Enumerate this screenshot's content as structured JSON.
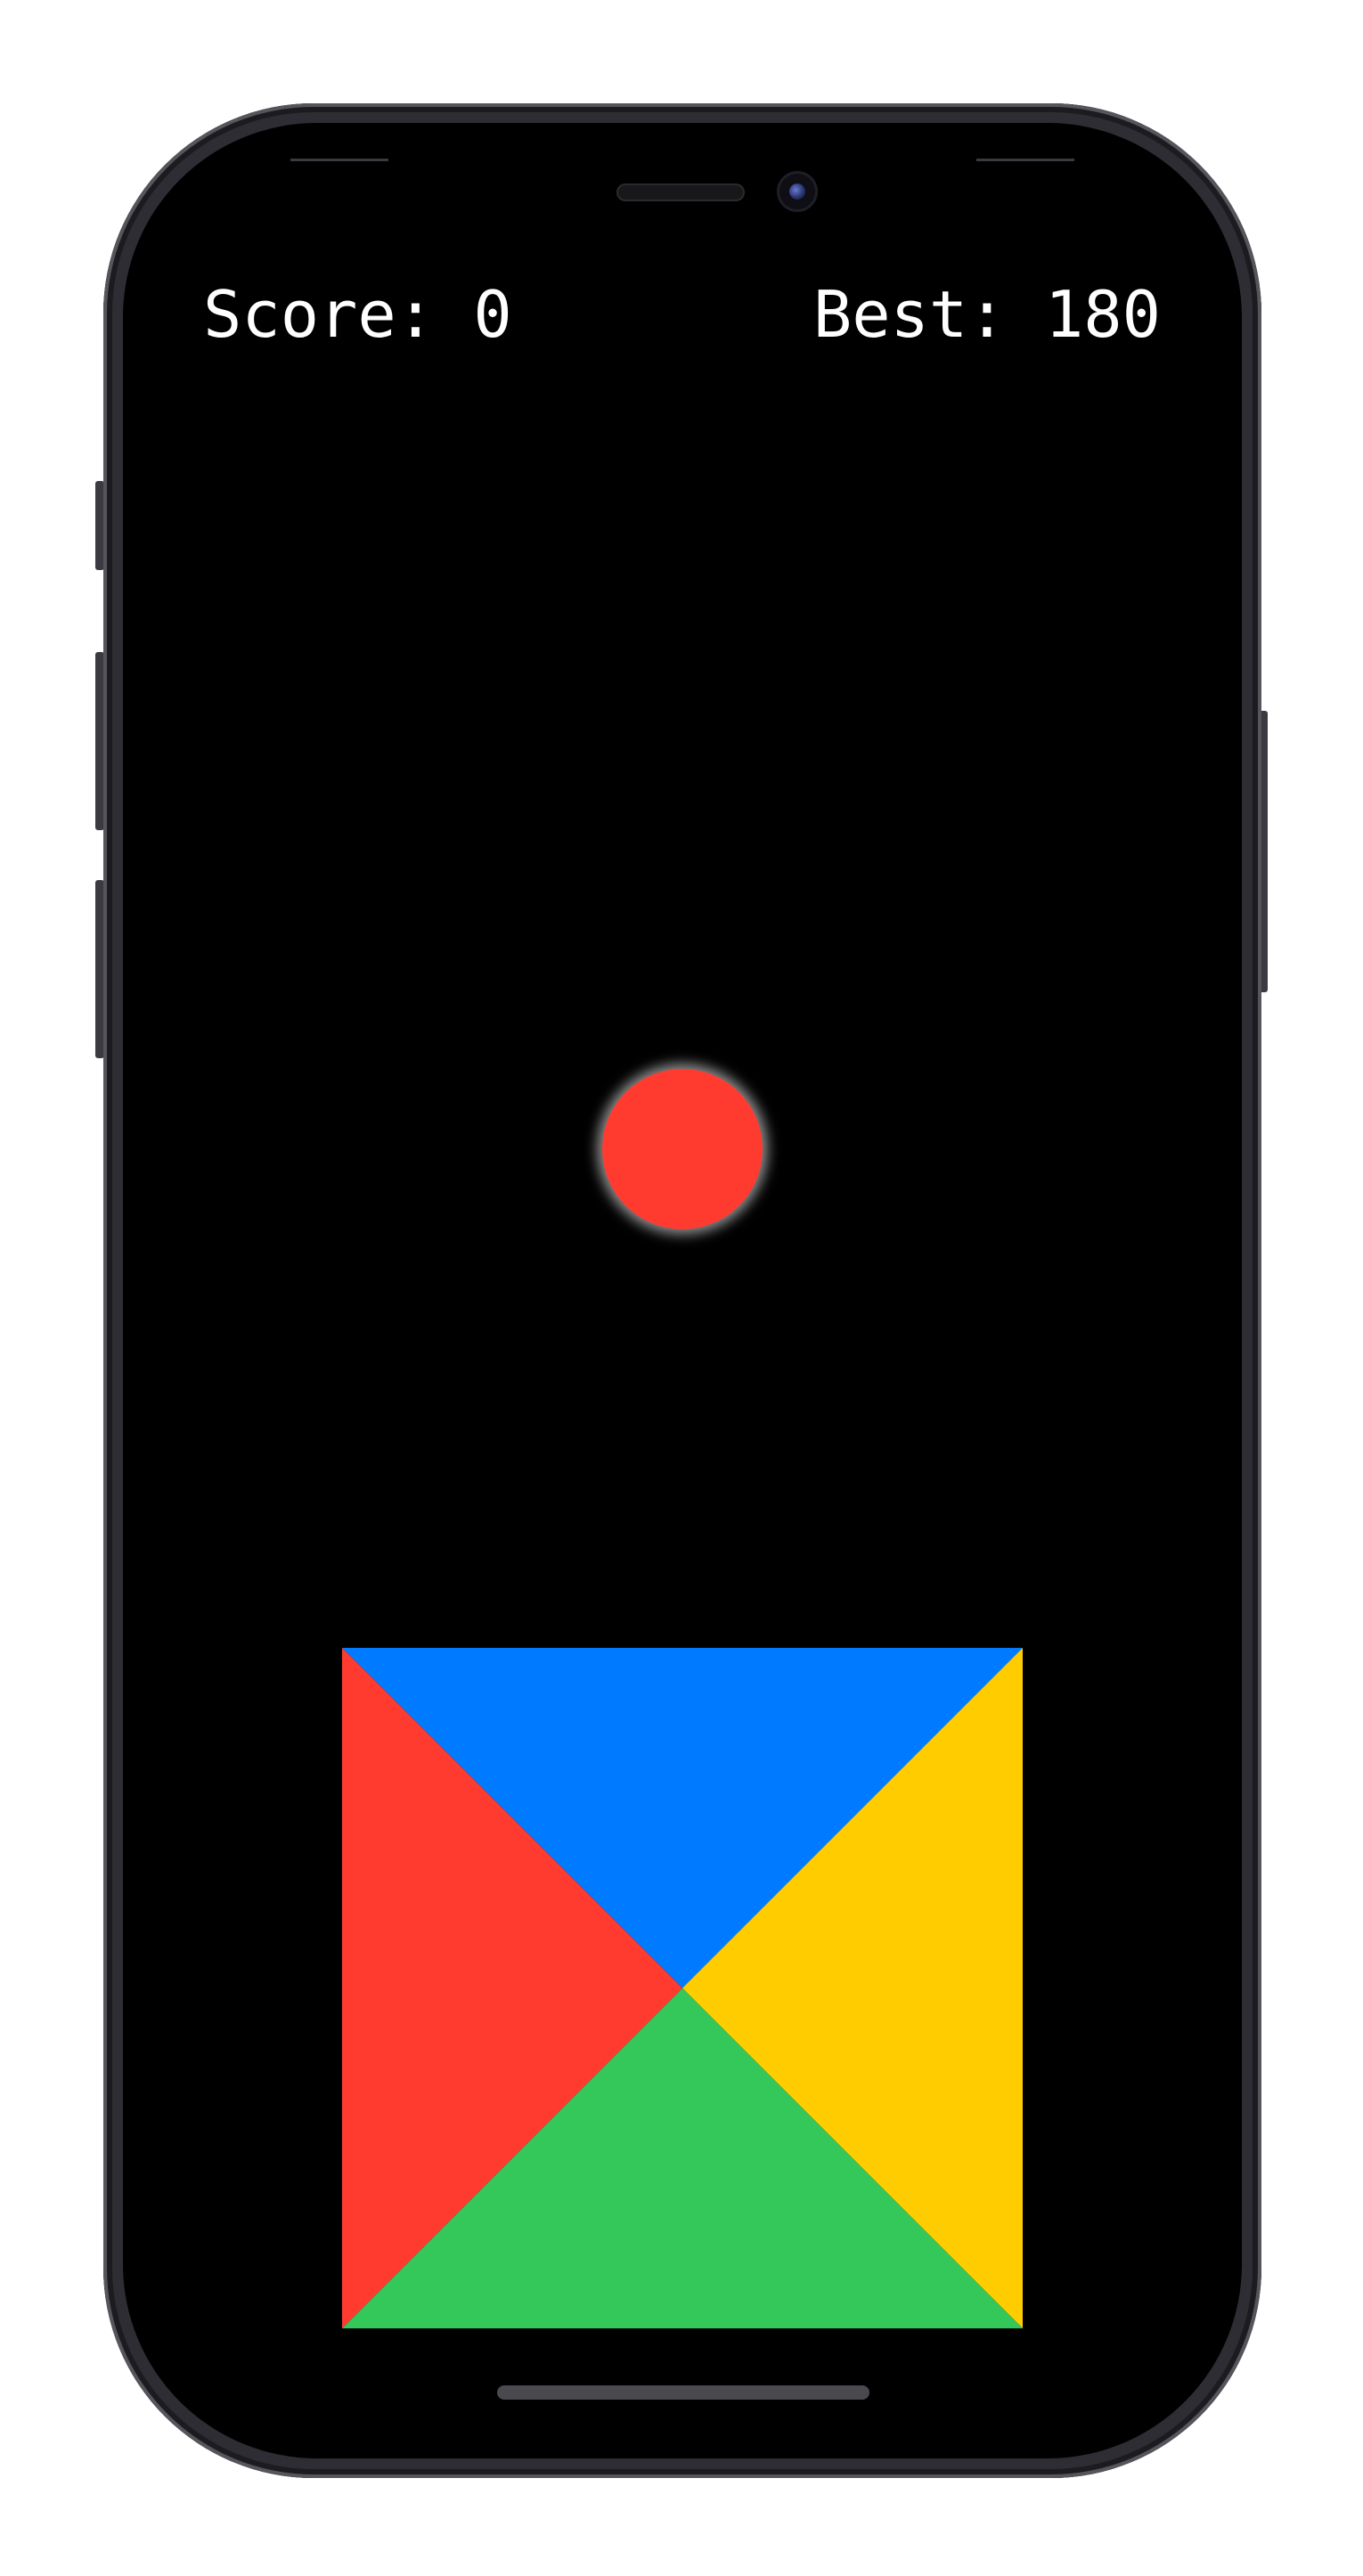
{
  "hud": {
    "score_text": "Score: 0",
    "best_text": "Best: 180"
  },
  "game": {
    "score": 0,
    "best": 180,
    "ball": {
      "color": "#FF3B30",
      "color_name": "red"
    },
    "rotator": {
      "segments": [
        {
          "position": "top",
          "color": "#007AFF",
          "color_name": "blue"
        },
        {
          "position": "right",
          "color": "#FFCC00",
          "color_name": "yellow"
        },
        {
          "position": "bottom",
          "color": "#34C759",
          "color_name": "green"
        },
        {
          "position": "left",
          "color": "#FF3B30",
          "color_name": "red"
        }
      ]
    }
  },
  "colors": {
    "background": "#000000",
    "text": "#FFFFFF"
  }
}
